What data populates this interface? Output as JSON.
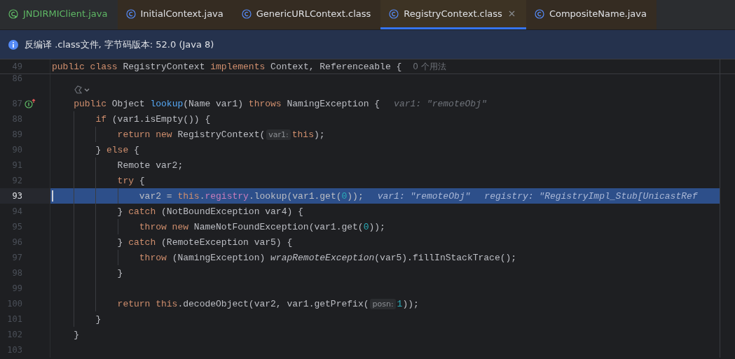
{
  "tabs": [
    {
      "label": "JNDIRMIClient.java",
      "kind": "runnable",
      "selected": false,
      "closable": false
    },
    {
      "label": "InitialContext.java",
      "kind": "class",
      "selected": false,
      "closable": false
    },
    {
      "label": "GenericURLContext.class",
      "kind": "class",
      "selected": false,
      "closable": false
    },
    {
      "label": "RegistryContext.class",
      "kind": "class",
      "selected": true,
      "closable": true
    },
    {
      "label": "CompositeName.java",
      "kind": "class",
      "selected": false,
      "closable": false
    }
  ],
  "info_bar": {
    "text": "反编译 .class文件, 字节码版本: 52.0 (Java 8)"
  },
  "sticky_line": {
    "number": "49",
    "segments": [
      {
        "kind": "code",
        "tokens": [
          {
            "kind": "keyword",
            "t": "public class "
          },
          {
            "kind": "plain",
            "t": "RegistryContext "
          },
          {
            "kind": "keyword",
            "t": "implements "
          },
          {
            "kind": "plain",
            "t": "Context, Referenceable {"
          }
        ]
      },
      {
        "kind": "usages",
        "text": "0 个用法"
      }
    ]
  },
  "lines": [
    {
      "kind": "partial",
      "number": "86",
      "selected": false
    },
    {
      "kind": "lens",
      "selected": false
    },
    {
      "kind": "code",
      "number": "87",
      "implementation_marker": true,
      "selected": false,
      "segments": [
        {
          "kind": "code",
          "tokens": [
            {
              "kind": "keyword",
              "t": "public "
            },
            {
              "kind": "plain",
              "t": "Object "
            },
            {
              "kind": "declaration",
              "t": "lookup"
            },
            {
              "kind": "plain",
              "t": "(Name var1) "
            },
            {
              "kind": "keyword",
              "t": "throws "
            },
            {
              "kind": "plain",
              "t": "NamingException {"
            }
          ]
        },
        {
          "kind": "debug",
          "text": "var1: \"remoteObj\""
        }
      ],
      "children": [
        {
          "kind": "code",
          "number": "88",
          "selected": false,
          "segments": [
            {
              "kind": "code",
              "tokens": [
                {
                  "kind": "keyword",
                  "t": "if "
                },
                {
                  "kind": "plain",
                  "t": "(var1.isEmpty()) {"
                }
              ]
            }
          ],
          "children": [
            {
              "kind": "code",
              "number": "89",
              "selected": false,
              "segments": [
                {
                  "kind": "code",
                  "tokens": [
                    {
                      "kind": "keyword",
                      "t": "return new "
                    },
                    {
                      "kind": "plain",
                      "t": "RegistryContext("
                    }
                  ]
                },
                {
                  "kind": "inlay",
                  "text": "var1:"
                },
                {
                  "kind": "code",
                  "tokens": [
                    {
                      "kind": "keyword",
                      "t": "this"
                    },
                    {
                      "kind": "plain",
                      "t": ");"
                    }
                  ]
                }
              ]
            }
          ]
        },
        {
          "kind": "code",
          "number": "90",
          "selected": false,
          "segments": [
            {
              "kind": "code",
              "tokens": [
                {
                  "kind": "plain",
                  "t": "} "
                },
                {
                  "kind": "keyword",
                  "t": "else "
                },
                {
                  "kind": "plain",
                  "t": "{"
                }
              ]
            }
          ],
          "children": [
            {
              "kind": "code",
              "number": "91",
              "selected": false,
              "segments": [
                {
                  "kind": "code",
                  "tokens": [
                    {
                      "kind": "plain",
                      "t": "Remote var2;"
                    }
                  ]
                }
              ]
            },
            {
              "kind": "code",
              "number": "92",
              "selected": false,
              "segments": [
                {
                  "kind": "code",
                  "tokens": [
                    {
                      "kind": "keyword",
                      "t": "try "
                    },
                    {
                      "kind": "plain",
                      "t": "{"
                    }
                  ]
                }
              ],
              "children": [
                {
                  "kind": "code",
                  "number": "93",
                  "selected": true,
                  "segments": [
                    {
                      "kind": "code",
                      "tokens": [
                        {
                          "kind": "plain",
                          "t": "var2 = "
                        },
                        {
                          "kind": "keyword",
                          "t": "this"
                        },
                        {
                          "kind": "plain",
                          "t": "."
                        },
                        {
                          "kind": "field",
                          "t": "registry"
                        },
                        {
                          "kind": "plain",
                          "t": ".lookup(var1.get("
                        },
                        {
                          "kind": "number",
                          "t": "0"
                        },
                        {
                          "kind": "plain",
                          "t": "));"
                        }
                      ]
                    },
                    {
                      "kind": "debug",
                      "text": "var1: \"remoteObj\""
                    },
                    {
                      "kind": "debug",
                      "text": "registry: \"RegistryImpl_Stub[UnicastRef"
                    }
                  ]
                }
              ]
            },
            {
              "kind": "code",
              "number": "94",
              "selected": false,
              "segments": [
                {
                  "kind": "code",
                  "tokens": [
                    {
                      "kind": "plain",
                      "t": "} "
                    },
                    {
                      "kind": "keyword",
                      "t": "catch "
                    },
                    {
                      "kind": "plain",
                      "t": "(NotBoundException var4) {"
                    }
                  ]
                }
              ],
              "children": [
                {
                  "kind": "code",
                  "number": "95",
                  "selected": false,
                  "segments": [
                    {
                      "kind": "code",
                      "tokens": [
                        {
                          "kind": "keyword",
                          "t": "throw new "
                        },
                        {
                          "kind": "plain",
                          "t": "NameNotFoundException(var1.get("
                        },
                        {
                          "kind": "number",
                          "t": "0"
                        },
                        {
                          "kind": "plain",
                          "t": "));"
                        }
                      ]
                    }
                  ]
                }
              ]
            },
            {
              "kind": "code",
              "number": "96",
              "selected": false,
              "segments": [
                {
                  "kind": "code",
                  "tokens": [
                    {
                      "kind": "plain",
                      "t": "} "
                    },
                    {
                      "kind": "keyword",
                      "t": "catch "
                    },
                    {
                      "kind": "plain",
                      "t": "(RemoteException var5) {"
                    }
                  ]
                }
              ],
              "children": [
                {
                  "kind": "code",
                  "number": "97",
                  "selected": false,
                  "segments": [
                    {
                      "kind": "code",
                      "tokens": [
                        {
                          "kind": "keyword",
                          "t": "throw "
                        },
                        {
                          "kind": "plain",
                          "t": "(NamingException) "
                        },
                        {
                          "kind": "static",
                          "t": "wrapRemoteException"
                        },
                        {
                          "kind": "plain",
                          "t": "(var5).fillInStackTrace();"
                        }
                      ]
                    }
                  ]
                }
              ]
            },
            {
              "kind": "code",
              "number": "98",
              "selected": false,
              "segments": [
                {
                  "kind": "code",
                  "tokens": [
                    {
                      "kind": "plain",
                      "t": "}"
                    }
                  ]
                }
              ]
            },
            {
              "kind": "code",
              "number": "99",
              "selected": false
            },
            {
              "kind": "code",
              "number": "100",
              "selected": false,
              "segments": [
                {
                  "kind": "code",
                  "tokens": [
                    {
                      "kind": "keyword",
                      "t": "return this"
                    },
                    {
                      "kind": "plain",
                      "t": ".decodeObject(var2, var1.getPrefix("
                    }
                  ]
                },
                {
                  "kind": "inlay",
                  "text": "posn:"
                },
                {
                  "kind": "code",
                  "tokens": [
                    {
                      "kind": "number",
                      "t": "1"
                    },
                    {
                      "kind": "plain",
                      "t": "));"
                    }
                  ]
                }
              ]
            }
          ]
        },
        {
          "kind": "code",
          "number": "101",
          "selected": false,
          "segments": [
            {
              "kind": "code",
              "tokens": [
                {
                  "kind": "plain",
                  "t": "}"
                }
              ]
            }
          ]
        }
      ]
    },
    {
      "kind": "code",
      "number": "102",
      "selected": false,
      "segments": [
        {
          "kind": "code",
          "tokens": [
            {
              "kind": "plain",
              "t": "}"
            }
          ]
        }
      ]
    },
    {
      "kind": "code",
      "number": "103",
      "selected": false
    }
  ]
}
